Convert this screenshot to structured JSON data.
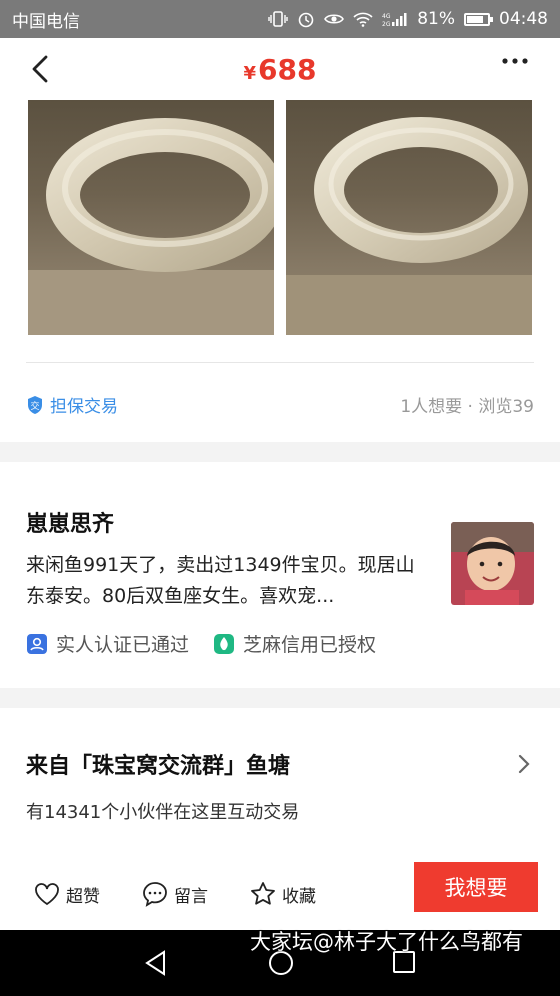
{
  "status_bar": {
    "carrier": "中国电信",
    "battery": "81%",
    "time": "04:48",
    "battery_level": 0.81
  },
  "nav": {
    "currency": "¥",
    "price": "688"
  },
  "product": {
    "guarantee_label": "担保交易",
    "stats": "1人想要 · 浏览39"
  },
  "seller": {
    "name": "崽崽思齐",
    "description": "来闲鱼991天了，卖出过1349件宝贝。现居山东泰安。80后双鱼座女生。喜欢宠...",
    "badge_real_name": "实人认证已通过",
    "badge_zhima": "芝麻信用已授权"
  },
  "pond": {
    "title": "来自「珠宝窝交流群」鱼塘",
    "subtitle": "有14341个小伙伴在这里互动交易"
  },
  "actions": {
    "like": "超赞",
    "message": "留言",
    "favorite": "收藏",
    "want": "我想要"
  },
  "watermark": "大家坛@林子大了什么鸟都有",
  "colors": {
    "accent_red": "#ef3b2f",
    "link_blue": "#3a8ee6",
    "zhima_green": "#1fb883"
  }
}
